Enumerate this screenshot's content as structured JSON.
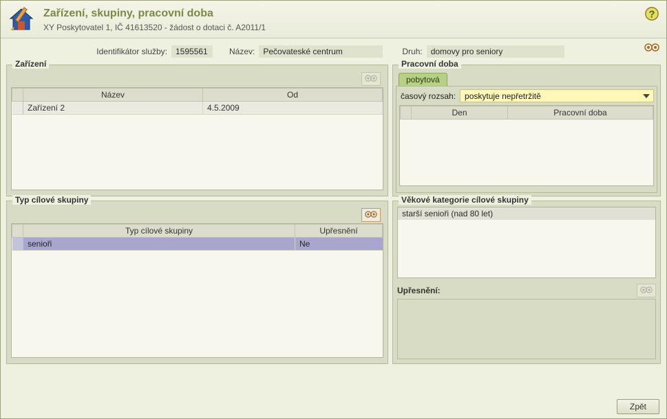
{
  "header": {
    "title": "Zařízení, skupiny, pracovní doba",
    "subtitle": "XY Poskytovatel 1, IČ 41613520 - žádost o dotaci č. A2011/1"
  },
  "info": {
    "id_label": "Identifikátor služby:",
    "id_value": "1595561",
    "name_label": "Název:",
    "name_value": "Pečovateské centrum",
    "kind_label": "Druh:",
    "kind_value": "domovy pro seniory"
  },
  "panels": {
    "zarizeni": {
      "legend": "Zařízení",
      "col_name": "Název",
      "col_from": "Od",
      "rows": [
        {
          "name": "Zařízení 2",
          "from": "4.5.2009"
        }
      ]
    },
    "pracovni_doba": {
      "legend": "Pracovní doba",
      "tab_label": "pobytová",
      "rozsah_label": "časový rozsah:",
      "rozsah_value": "poskytuje nepřetržitě",
      "col_day": "Den",
      "col_hours": "Pracovní doba"
    },
    "typ_skupiny": {
      "legend": "Typ cílové skupiny",
      "col_type": "Typ cílové skupiny",
      "col_detail": "Upřesnění",
      "rows": [
        {
          "type": "senioři",
          "detail": "Ne"
        }
      ]
    },
    "vekove": {
      "legend": "Věkové kategorie cílové skupiny",
      "items": [
        "starší senioři (nad 80 let)"
      ],
      "upresneni_label": "Upřesnění:"
    }
  },
  "footer": {
    "back_label": "Zpět"
  },
  "icons": {
    "help": "help-icon",
    "header": "house-pencil-icon",
    "eyes": "glasses-icon"
  }
}
